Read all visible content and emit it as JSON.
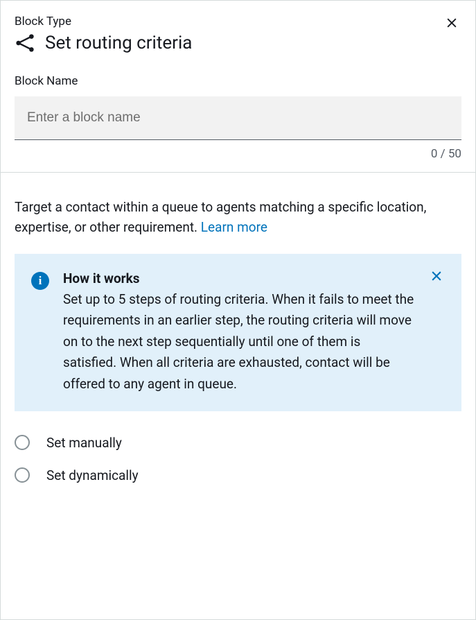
{
  "header": {
    "block_type_label": "Block Type",
    "title": "Set routing criteria"
  },
  "block_name": {
    "label": "Block Name",
    "placeholder": "Enter a block name",
    "value": "",
    "counter": "0 / 50"
  },
  "description": {
    "text": "Target a contact within a queue to agents matching a specific location, expertise, or other requirement. ",
    "learn_more": "Learn more"
  },
  "info_box": {
    "title": "How it works",
    "body": "Set up to 5 steps of routing criteria. When it fails to meet the requirements in an earlier step, the routing criteria will move on to the next step sequentially until one of them is satisfied. When all criteria are exhausted, contact will be offered to any agent in queue."
  },
  "options": {
    "manual": "Set manually",
    "dynamic": "Set dynamically"
  }
}
